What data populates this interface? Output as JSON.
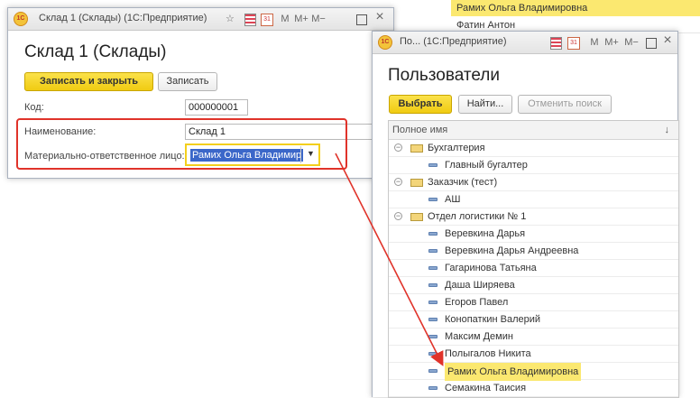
{
  "background_list": {
    "selected": "Рамих Ольга Владимировна",
    "next": "Фатин Антон"
  },
  "sklad_window": {
    "title": "Склад 1 (Склады)  (1С:Предприятие)",
    "icons": [
      "star-icon",
      "report-icon",
      "calendar-icon",
      "M",
      "M+",
      "M-",
      "maximize-icon",
      "close-icon"
    ],
    "calendar_label": "31",
    "m": "M",
    "m_plus": "M+",
    "m_minus": "M−",
    "close": "×",
    "heading": "Склад 1 (Склады)",
    "save_close": "Записать и закрыть",
    "save": "Записать",
    "code_label": "Код:",
    "code_value": "000000001",
    "name_label": "Наименование:",
    "name_value": "Склад 1",
    "responsible_label": "Материально-ответственное лицо:",
    "responsible_value": "Рамих Ольга Владимир"
  },
  "users_window": {
    "title": "По...  (1С:Предприятие)",
    "calendar_label": "31",
    "m": "M",
    "m_plus": "M+",
    "m_minus": "M−",
    "close": "×",
    "heading": "Пользователи",
    "select_btn": "Выбрать",
    "find_btn": "Найти...",
    "cancel_search_btn": "Отменить поиск",
    "column_header": "Полное имя",
    "sort_arrow": "↓",
    "rows": [
      {
        "text": "Бухгалтерия",
        "type": "group"
      },
      {
        "text": "Главный бугалтер",
        "type": "user"
      },
      {
        "text": "Заказчик (тест)",
        "type": "group"
      },
      {
        "text": "АШ",
        "type": "user"
      },
      {
        "text": "Отдел логистики № 1",
        "type": "group"
      },
      {
        "text": "Веревкина Дарья",
        "type": "user"
      },
      {
        "text": "Веревкина Дарья Андреевна",
        "type": "user"
      },
      {
        "text": "Гагаринова Татьяна",
        "type": "user"
      },
      {
        "text": "Даша Ширяева",
        "type": "user"
      },
      {
        "text": "Егоров Павел",
        "type": "user"
      },
      {
        "text": "Конопаткин Валерий",
        "type": "user"
      },
      {
        "text": "Максим Демин",
        "type": "user"
      },
      {
        "text": "Полыгалов Никита",
        "type": "user"
      },
      {
        "text": "Рамих Ольга Владимировна",
        "type": "user",
        "selected": true
      },
      {
        "text": "Семакина Таисия",
        "type": "user"
      }
    ]
  },
  "colors": {
    "highlight": "#fbe870",
    "accent_yellow": "#f3cf1c",
    "annotation_red": "#e0332a"
  }
}
